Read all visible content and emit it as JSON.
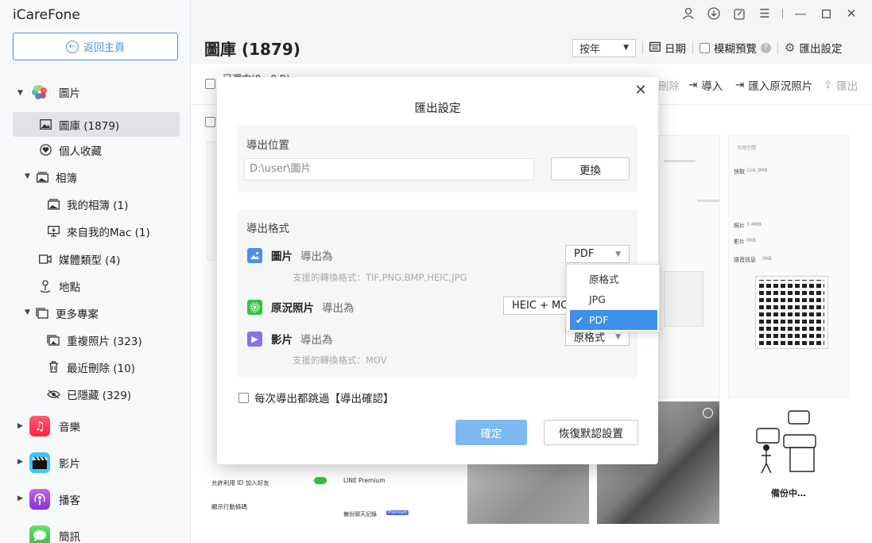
{
  "app": {
    "name": "iCareFone",
    "home_label": "返回主頁"
  },
  "sidebar": {
    "photos": "圖片",
    "library": "圖庫 (1879)",
    "favorites": "個人收藏",
    "albums": "相簿",
    "my_albums": "我的相簿 (1)",
    "from_mac": "來自我的Mac (1)",
    "media_types": "媒體類型 (4)",
    "places": "地點",
    "more": "更多專案",
    "duplicates": "重複照片 (323)",
    "recently_deleted": "最近刪除 (10)",
    "hidden": "已隱藏 (329)",
    "music": "音樂",
    "videos": "影片",
    "podcasts": "播客",
    "messages": "簡訊"
  },
  "header": {
    "title": "圖庫 (1879)",
    "group_by": "按年",
    "date": "日期",
    "blur_preview": "模糊預覽",
    "export_settings": "匯出設定"
  },
  "actions": {
    "selected": "已選中(0，0 B)",
    "delete": "刪除",
    "import": "導入",
    "import_live": "匯入原況照片",
    "export": "匯出"
  },
  "background": {
    "friend_setting": "允許利用 ID 加入好友",
    "show_code": "顯示行動條碼",
    "line_premium": "LINE Premium",
    "backup_chat": "備份聊天記錄",
    "premium_badge": "Premium",
    "backing_up": "備份中…",
    "free_space": "可用空間",
    "cache": "快取",
    "cache_size": "156.3MB",
    "photos": "照片",
    "photos_size": "3.4MB",
    "videos": "影片",
    "videos_size": "0KB",
    "voice": "語音訊息",
    "voice_size": "0KB",
    "phone": "5387155088"
  },
  "modal": {
    "title": "匯出設定",
    "location_label": "導出位置",
    "path": "D:\\user\\圖片",
    "change": "更換",
    "format_label": "導出格式",
    "photo_name": "圖片",
    "photo_as": "導出為",
    "photo_value": "PDF",
    "photo_hint": "支援的轉換格式：TIF,PNG,BMP,HEIC,JPG",
    "live_name": "原況照片",
    "live_as": "導出為",
    "live_value": "HEIC + MOV",
    "video_name": "影片",
    "video_as": "導出為",
    "video_value": "原格式",
    "video_hint": "支援的轉換格式：MOV",
    "dropdown_options": [
      "原格式",
      "JPG",
      "PDF"
    ],
    "skip_confirm": "每次導出都跳過【導出確認】",
    "ok": "確定",
    "reset": "恢復默認設置"
  },
  "colors": {
    "accent": "#4a90e2",
    "primary_btn": "#7cb9f0",
    "selected_option": "#3d8fe8"
  }
}
